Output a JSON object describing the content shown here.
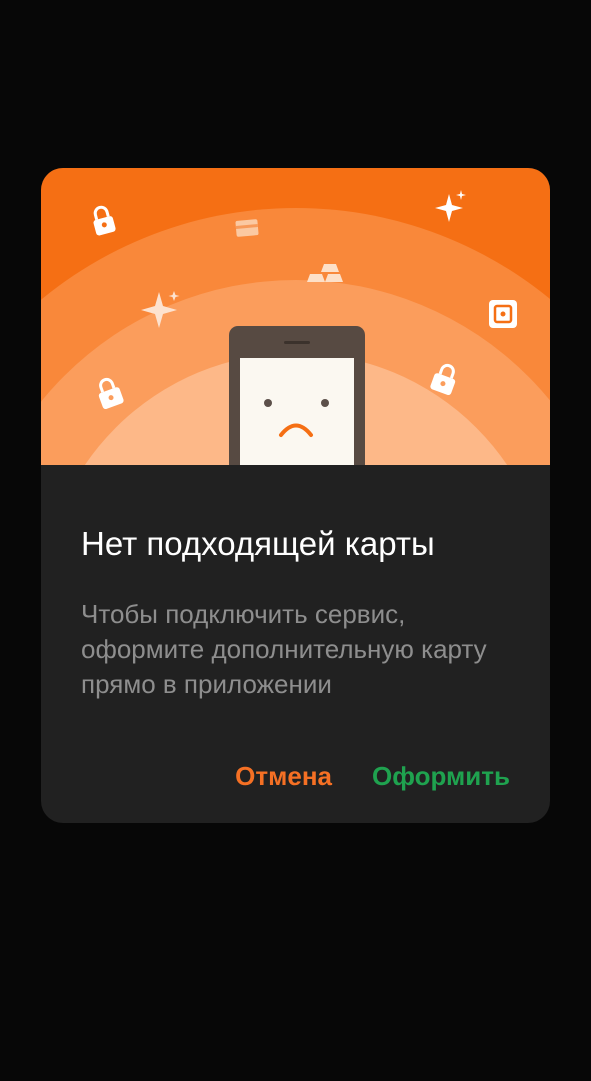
{
  "dialog": {
    "title": "Нет подходящей карты",
    "message": "Чтобы подключить сервис, оформите дополнительную карту прямо в приложении",
    "cancel_label": "Отмена",
    "confirm_label": "Оформить"
  },
  "colors": {
    "background": "#070707",
    "dialog_background": "#212121",
    "hero_orange": "#f56f14",
    "cancel": "#f57024",
    "confirm": "#1fa24f"
  },
  "illustration": {
    "icons": [
      "lock-icon",
      "card-icon",
      "sparkle-icon",
      "gold-bars-icon",
      "safe-icon",
      "phone-sad-face"
    ]
  }
}
